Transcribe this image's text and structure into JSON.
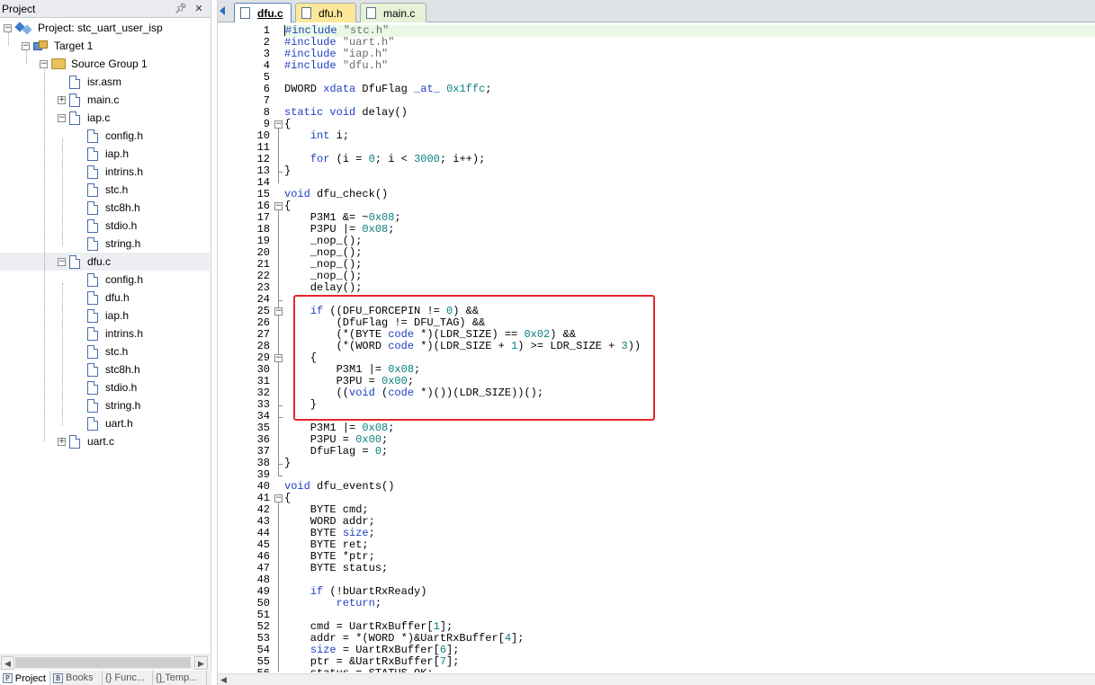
{
  "project_panel": {
    "title": "Project",
    "pin_icon": "pin-icon",
    "close_icon": "close-icon",
    "tree": [
      {
        "label": "Project: stc_uart_user_isp",
        "kind": "project",
        "expander": "−"
      },
      {
        "label": "Target 1",
        "kind": "target",
        "expander": "−"
      },
      {
        "label": "Source Group 1",
        "kind": "folder",
        "expander": "−"
      },
      {
        "label": "isr.asm",
        "kind": "file",
        "expander": ""
      },
      {
        "label": "main.c",
        "kind": "file",
        "expander": "+"
      },
      {
        "label": "iap.c",
        "kind": "file",
        "expander": "−"
      },
      {
        "label": "config.h",
        "kind": "file",
        "expander": ""
      },
      {
        "label": "iap.h",
        "kind": "file",
        "expander": ""
      },
      {
        "label": "intrins.h",
        "kind": "file",
        "expander": ""
      },
      {
        "label": "stc.h",
        "kind": "file",
        "expander": ""
      },
      {
        "label": "stc8h.h",
        "kind": "file",
        "expander": ""
      },
      {
        "label": "stdio.h",
        "kind": "file",
        "expander": ""
      },
      {
        "label": "string.h",
        "kind": "file",
        "expander": ""
      },
      {
        "label": "dfu.c",
        "kind": "file",
        "expander": "−",
        "selected": true
      },
      {
        "label": "config.h",
        "kind": "file",
        "expander": ""
      },
      {
        "label": "dfu.h",
        "kind": "file",
        "expander": ""
      },
      {
        "label": "iap.h",
        "kind": "file",
        "expander": ""
      },
      {
        "label": "intrins.h",
        "kind": "file",
        "expander": ""
      },
      {
        "label": "stc.h",
        "kind": "file",
        "expander": ""
      },
      {
        "label": "stc8h.h",
        "kind": "file",
        "expander": ""
      },
      {
        "label": "stdio.h",
        "kind": "file",
        "expander": ""
      },
      {
        "label": "string.h",
        "kind": "file",
        "expander": ""
      },
      {
        "label": "uart.h",
        "kind": "file",
        "expander": ""
      },
      {
        "label": "uart.c",
        "kind": "file",
        "expander": "+"
      }
    ],
    "bottom_tabs": [
      {
        "label": "Project",
        "icon": "P",
        "active": true
      },
      {
        "label": "Books",
        "icon": "B",
        "active": false
      },
      {
        "label": "{} Func...",
        "icon": "",
        "active": false
      },
      {
        "label": "{}̲ Temp...",
        "icon": "",
        "active": false
      }
    ]
  },
  "editor": {
    "tabs": [
      {
        "label": "dfu.c",
        "active": true
      },
      {
        "label": "dfu.h",
        "active": false
      },
      {
        "label": "main.c",
        "active": false
      }
    ],
    "lines": [
      [
        [
          "pp",
          "#include "
        ],
        [
          "str",
          "\"stc.h\""
        ]
      ],
      [
        [
          "pp",
          "#include "
        ],
        [
          "str",
          "\"uart.h\""
        ]
      ],
      [
        [
          "pp",
          "#include "
        ],
        [
          "str",
          "\"iap.h\""
        ]
      ],
      [
        [
          "pp",
          "#include "
        ],
        [
          "str",
          "\"dfu.h\""
        ]
      ],
      [],
      [
        [
          "t",
          "DWORD "
        ],
        [
          "kw",
          "xdata"
        ],
        [
          "t",
          " DfuFlag "
        ],
        [
          "kw",
          "_at_"
        ],
        [
          "t",
          " "
        ],
        [
          "num",
          "0x1ffc"
        ],
        [
          "t",
          ";"
        ]
      ],
      [],
      [
        [
          "kw",
          "static"
        ],
        [
          "t",
          " "
        ],
        [
          "kw",
          "void"
        ],
        [
          "t",
          " delay()"
        ]
      ],
      [
        [
          "t",
          "{"
        ]
      ],
      [
        [
          "t",
          "    "
        ],
        [
          "kw",
          "int"
        ],
        [
          "t",
          " i;"
        ]
      ],
      [],
      [
        [
          "t",
          "    "
        ],
        [
          "kw",
          "for"
        ],
        [
          "t",
          " (i = "
        ],
        [
          "num",
          "0"
        ],
        [
          "t",
          "; i < "
        ],
        [
          "num",
          "3000"
        ],
        [
          "t",
          "; i++);"
        ]
      ],
      [
        [
          "t",
          "}"
        ]
      ],
      [],
      [
        [
          "kw",
          "void"
        ],
        [
          "t",
          " dfu_check()"
        ]
      ],
      [
        [
          "t",
          "{"
        ]
      ],
      [
        [
          "t",
          "    P3M1 &= ~"
        ],
        [
          "num",
          "0x08"
        ],
        [
          "t",
          ";"
        ]
      ],
      [
        [
          "t",
          "    P3PU |= "
        ],
        [
          "num",
          "0x08"
        ],
        [
          "t",
          ";"
        ]
      ],
      [
        [
          "t",
          "    _nop_();"
        ]
      ],
      [
        [
          "t",
          "    _nop_();"
        ]
      ],
      [
        [
          "t",
          "    _nop_();"
        ]
      ],
      [
        [
          "t",
          "    _nop_();"
        ]
      ],
      [
        [
          "t",
          "    delay();"
        ]
      ],
      [],
      [
        [
          "t",
          "    "
        ],
        [
          "kw",
          "if"
        ],
        [
          "t",
          " ((DFU_FORCEPIN != "
        ],
        [
          "num",
          "0"
        ],
        [
          "t",
          ") &&"
        ]
      ],
      [
        [
          "t",
          "        (DfuFlag != DFU_TAG) &&"
        ]
      ],
      [
        [
          "t",
          "        (*(BYTE "
        ],
        [
          "kw",
          "code"
        ],
        [
          "t",
          " *)(LDR_SIZE) == "
        ],
        [
          "num",
          "0x02"
        ],
        [
          "t",
          ") &&"
        ]
      ],
      [
        [
          "t",
          "        (*(WORD "
        ],
        [
          "kw",
          "code"
        ],
        [
          "t",
          " *)(LDR_SIZE + "
        ],
        [
          "num",
          "1"
        ],
        [
          "t",
          ") >= LDR_SIZE + "
        ],
        [
          "num",
          "3"
        ],
        [
          "t",
          "))"
        ]
      ],
      [
        [
          "t",
          "    {"
        ]
      ],
      [
        [
          "t",
          "        P3M1 |= "
        ],
        [
          "num",
          "0x08"
        ],
        [
          "t",
          ";"
        ]
      ],
      [
        [
          "t",
          "        P3PU = "
        ],
        [
          "num",
          "0x00"
        ],
        [
          "t",
          ";"
        ]
      ],
      [
        [
          "t",
          "        (("
        ],
        [
          "kw",
          "void"
        ],
        [
          "t",
          " ("
        ],
        [
          "kw",
          "code"
        ],
        [
          "t",
          " *)())(LDR_SIZE))();"
        ]
      ],
      [
        [
          "t",
          "    }"
        ]
      ],
      [],
      [
        [
          "t",
          "    P3M1 |= "
        ],
        [
          "num",
          "0x08"
        ],
        [
          "t",
          ";"
        ]
      ],
      [
        [
          "t",
          "    P3PU = "
        ],
        [
          "num",
          "0x00"
        ],
        [
          "t",
          ";"
        ]
      ],
      [
        [
          "t",
          "    DfuFlag = "
        ],
        [
          "num",
          "0"
        ],
        [
          "t",
          ";"
        ]
      ],
      [
        [
          "t",
          "}"
        ]
      ],
      [],
      [
        [
          "kw",
          "void"
        ],
        [
          "t",
          " dfu_events()"
        ]
      ],
      [
        [
          "t",
          "{"
        ]
      ],
      [
        [
          "t",
          "    BYTE cmd;"
        ]
      ],
      [
        [
          "t",
          "    WORD addr;"
        ]
      ],
      [
        [
          "t",
          "    BYTE "
        ],
        [
          "kw",
          "size"
        ],
        [
          "t",
          ";"
        ]
      ],
      [
        [
          "t",
          "    BYTE ret;"
        ]
      ],
      [
        [
          "t",
          "    BYTE *ptr;"
        ]
      ],
      [
        [
          "t",
          "    BYTE status;"
        ]
      ],
      [],
      [
        [
          "t",
          "    "
        ],
        [
          "kw",
          "if"
        ],
        [
          "t",
          " (!bUartRxReady)"
        ]
      ],
      [
        [
          "t",
          "        "
        ],
        [
          "kw",
          "return"
        ],
        [
          "t",
          ";"
        ]
      ],
      [],
      [
        [
          "t",
          "    cmd = UartRxBuffer["
        ],
        [
          "num",
          "1"
        ],
        [
          "t",
          "];"
        ]
      ],
      [
        [
          "t",
          "    addr = *(WORD *)&UartRxBuffer["
        ],
        [
          "num",
          "4"
        ],
        [
          "t",
          "];"
        ]
      ],
      [
        [
          "t",
          "    "
        ],
        [
          "kw",
          "size"
        ],
        [
          "t",
          " = UartRxBuffer["
        ],
        [
          "num",
          "6"
        ],
        [
          "t",
          "];"
        ]
      ],
      [
        [
          "t",
          "    ptr = &UartRxBuffer["
        ],
        [
          "num",
          "7"
        ],
        [
          "t",
          "];"
        ]
      ],
      [
        [
          "t",
          "    status = STATUS_OK;"
        ]
      ]
    ],
    "fold_markers": [
      9,
      16,
      25,
      29,
      41
    ],
    "fold_ranges": [
      [
        9,
        14
      ],
      [
        16,
        39
      ],
      [
        29,
        33
      ],
      [
        41,
        56
      ]
    ],
    "fold_ends": [
      13,
      24,
      33,
      34,
      38,
      39
    ],
    "current_line": 1,
    "highlight_color": "#e8262b"
  }
}
